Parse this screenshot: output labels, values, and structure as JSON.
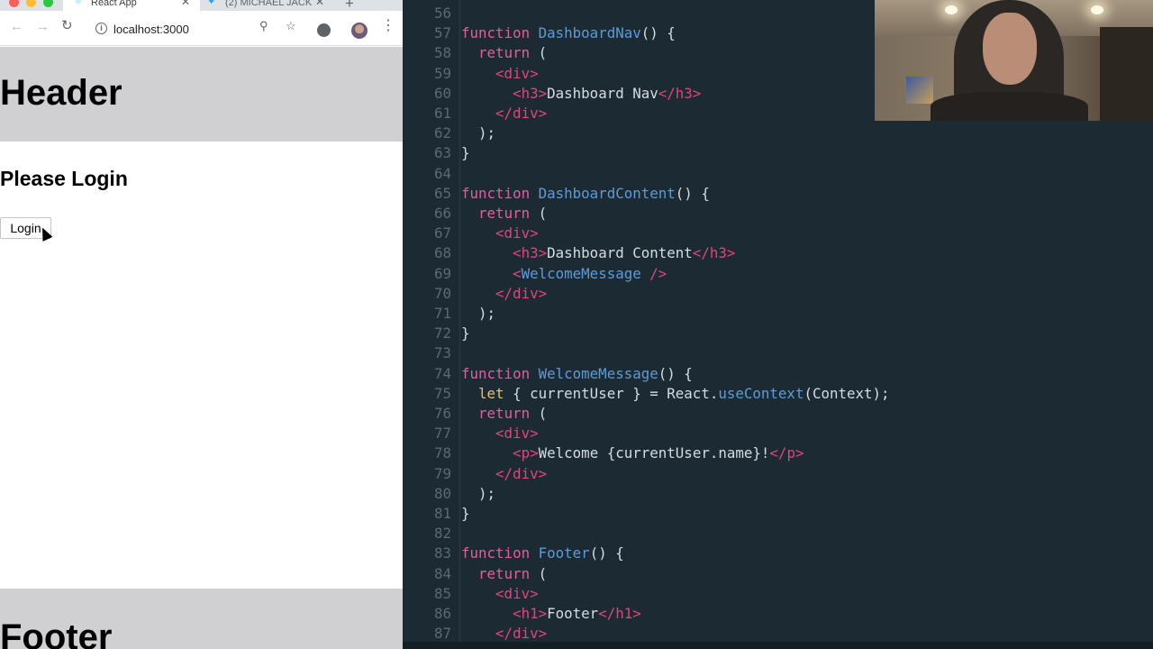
{
  "browser": {
    "tabs": [
      {
        "title": "React App",
        "active": true
      },
      {
        "title": "(2) MICHAEL JACK",
        "active": false
      }
    ],
    "new_tab_symbol": "+",
    "url": "localhost:3000",
    "icons": [
      "back-arrow-icon",
      "forward-arrow-icon",
      "reload-icon",
      "info-icon",
      "zoom-icon",
      "star-icon",
      "extension-icon",
      "profile-avatar",
      "more-menu-icon"
    ]
  },
  "page": {
    "header_text": "Header",
    "login_heading": "Please Login",
    "login_button": "Login",
    "footer_text": "Footer"
  },
  "editor": {
    "lines": [
      {
        "n": "56",
        "seg": []
      },
      {
        "n": "57",
        "seg": [
          [
            "kw",
            "function "
          ],
          [
            "fn",
            "DashboardNav"
          ],
          [
            "",
            "() {"
          ]
        ]
      },
      {
        "n": "58",
        "seg": [
          [
            "",
            "  "
          ],
          [
            "kw",
            "return"
          ],
          [
            "",
            " ("
          ]
        ]
      },
      {
        "n": "59",
        "seg": [
          [
            "",
            "    "
          ],
          [
            "tag",
            "<div>"
          ]
        ]
      },
      {
        "n": "60",
        "seg": [
          [
            "",
            "      "
          ],
          [
            "tag",
            "<h3>"
          ],
          [
            "",
            "Dashboard Nav"
          ],
          [
            "tag",
            "</h3>"
          ]
        ]
      },
      {
        "n": "61",
        "seg": [
          [
            "",
            "    "
          ],
          [
            "tag",
            "</div>"
          ]
        ]
      },
      {
        "n": "62",
        "seg": [
          [
            "",
            "  );"
          ]
        ]
      },
      {
        "n": "63",
        "seg": [
          [
            "",
            "}"
          ]
        ]
      },
      {
        "n": "64",
        "seg": []
      },
      {
        "n": "65",
        "seg": [
          [
            "kw",
            "function "
          ],
          [
            "fn",
            "DashboardContent"
          ],
          [
            "",
            "() {"
          ]
        ]
      },
      {
        "n": "66",
        "seg": [
          [
            "",
            "  "
          ],
          [
            "kw",
            "return"
          ],
          [
            "",
            " ("
          ]
        ]
      },
      {
        "n": "67",
        "seg": [
          [
            "",
            "    "
          ],
          [
            "tag",
            "<div>"
          ]
        ]
      },
      {
        "n": "68",
        "seg": [
          [
            "",
            "      "
          ],
          [
            "tag",
            "<h3>"
          ],
          [
            "",
            "Dashboard Content"
          ],
          [
            "tag",
            "</h3>"
          ]
        ]
      },
      {
        "n": "69",
        "seg": [
          [
            "",
            "      "
          ],
          [
            "tag",
            "<"
          ],
          [
            "comp",
            "WelcomeMessage"
          ],
          [
            "tag",
            " />"
          ]
        ]
      },
      {
        "n": "70",
        "seg": [
          [
            "",
            "    "
          ],
          [
            "tag",
            "</div>"
          ]
        ]
      },
      {
        "n": "71",
        "seg": [
          [
            "",
            "  );"
          ]
        ]
      },
      {
        "n": "72",
        "seg": [
          [
            "",
            "}"
          ]
        ]
      },
      {
        "n": "73",
        "seg": []
      },
      {
        "n": "74",
        "seg": [
          [
            "kw",
            "function "
          ],
          [
            "fn",
            "WelcomeMessage"
          ],
          [
            "",
            "() {"
          ]
        ]
      },
      {
        "n": "75",
        "seg": [
          [
            "",
            "  "
          ],
          [
            "let",
            "let"
          ],
          [
            "",
            " { currentUser } = React."
          ],
          [
            "fn",
            "useContext"
          ],
          [
            "",
            "(Context);"
          ]
        ]
      },
      {
        "n": "76",
        "seg": [
          [
            "",
            "  "
          ],
          [
            "kw",
            "return"
          ],
          [
            "",
            " ("
          ]
        ]
      },
      {
        "n": "77",
        "seg": [
          [
            "",
            "    "
          ],
          [
            "tag",
            "<div>"
          ]
        ]
      },
      {
        "n": "78",
        "seg": [
          [
            "",
            "      "
          ],
          [
            "tag",
            "<p>"
          ],
          [
            "",
            "Welcome {currentUser.name}!"
          ],
          [
            "tag",
            "</p>"
          ]
        ]
      },
      {
        "n": "79",
        "seg": [
          [
            "",
            "    "
          ],
          [
            "tag",
            "</div>"
          ]
        ]
      },
      {
        "n": "80",
        "seg": [
          [
            "",
            "  );"
          ]
        ]
      },
      {
        "n": "81",
        "seg": [
          [
            "",
            "}"
          ]
        ]
      },
      {
        "n": "82",
        "seg": []
      },
      {
        "n": "83",
        "seg": [
          [
            "kw",
            "function "
          ],
          [
            "fn",
            "Footer"
          ],
          [
            "",
            "() {"
          ]
        ]
      },
      {
        "n": "84",
        "seg": [
          [
            "",
            "  "
          ],
          [
            "kw",
            "return"
          ],
          [
            "",
            " ("
          ]
        ]
      },
      {
        "n": "85",
        "seg": [
          [
            "",
            "    "
          ],
          [
            "tag",
            "<div>"
          ]
        ]
      },
      {
        "n": "86",
        "seg": [
          [
            "",
            "      "
          ],
          [
            "tag",
            "<h1>"
          ],
          [
            "",
            "Footer"
          ],
          [
            "tag",
            "</h1>"
          ]
        ]
      },
      {
        "n": "87",
        "seg": [
          [
            "",
            "    "
          ],
          [
            "tag",
            "</div>"
          ]
        ]
      }
    ]
  },
  "colors": {
    "editor_bg": "#1c2a33",
    "keyword": "#e15fa0",
    "function_name": "#5d9cd6",
    "jsx_tag": "#e0467a",
    "plain_text": "#d5dde3",
    "line_number": "#5a6a74",
    "page_band": "#d0cfd2"
  }
}
